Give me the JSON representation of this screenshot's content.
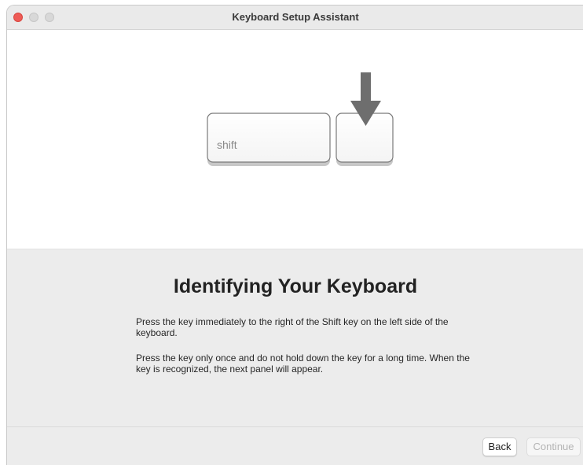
{
  "window": {
    "title": "Keyboard Setup Assistant"
  },
  "illustration": {
    "shift_key_label": "shift",
    "target_key_label": "",
    "arrow_icon": "down-arrow-icon"
  },
  "panel": {
    "heading": "Identifying Your Keyboard",
    "instruction_1": "Press the key immediately to the right of the Shift key on the left side of the keyboard.",
    "instruction_2": "Press the key only once and do not hold down the key for a long time. When the key is recognized, the next panel will appear."
  },
  "footer": {
    "back_label": "Back",
    "continue_label": "Continue"
  },
  "colors": {
    "close": "#ee5b56",
    "inactive_light": "#d8d8d8",
    "panel_bg": "#ececec",
    "arrow": "#6e6e6e"
  }
}
